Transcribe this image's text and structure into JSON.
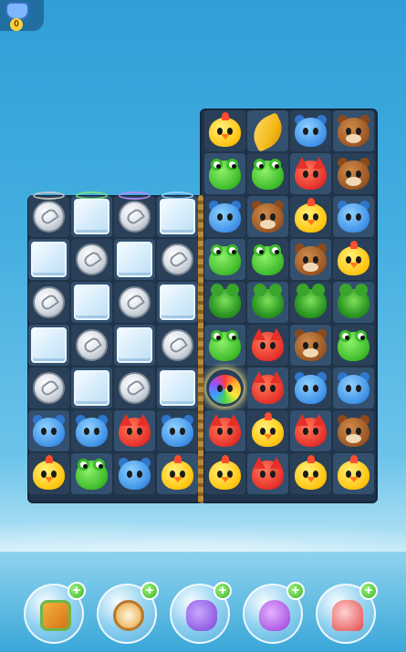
{
  "hud": {
    "counter_value": "0"
  },
  "board": {
    "rows": [
      [
        "",
        "",
        "",
        "",
        "chick",
        "banana",
        "hippo",
        "bear"
      ],
      [
        "",
        "",
        "",
        "",
        "frog",
        "frog",
        "fox",
        "bear"
      ],
      [
        "coin",
        "ice",
        "coin",
        "ice",
        "hippo",
        "bear",
        "chick",
        "hippo"
      ],
      [
        "ice",
        "coin",
        "ice",
        "coin",
        "frog",
        "frog",
        "bear",
        "chick"
      ],
      [
        "coin",
        "ice",
        "coin",
        "ice",
        "broccoli",
        "broccoli",
        "broccoli",
        "broccoli"
      ],
      [
        "ice",
        "coin",
        "ice",
        "coin",
        "frog",
        "fox",
        "bear",
        "frog"
      ],
      [
        "coin",
        "ice",
        "coin",
        "ice",
        "rainbow",
        "fox",
        "hippo",
        "hippo"
      ],
      [
        "hippo",
        "hippo",
        "fox",
        "hippo",
        "fox",
        "chick",
        "fox",
        "bear"
      ],
      [
        "chick",
        "frog",
        "hippo",
        "chick",
        "chick",
        "fox",
        "chick",
        "chick"
      ]
    ]
  },
  "boosters": [
    {
      "icon": "color-swap-icon"
    },
    {
      "icon": "clock-icon"
    },
    {
      "icon": "swap-pieces-icon"
    },
    {
      "icon": "fish-icon"
    },
    {
      "icon": "rocket-icon"
    }
  ]
}
